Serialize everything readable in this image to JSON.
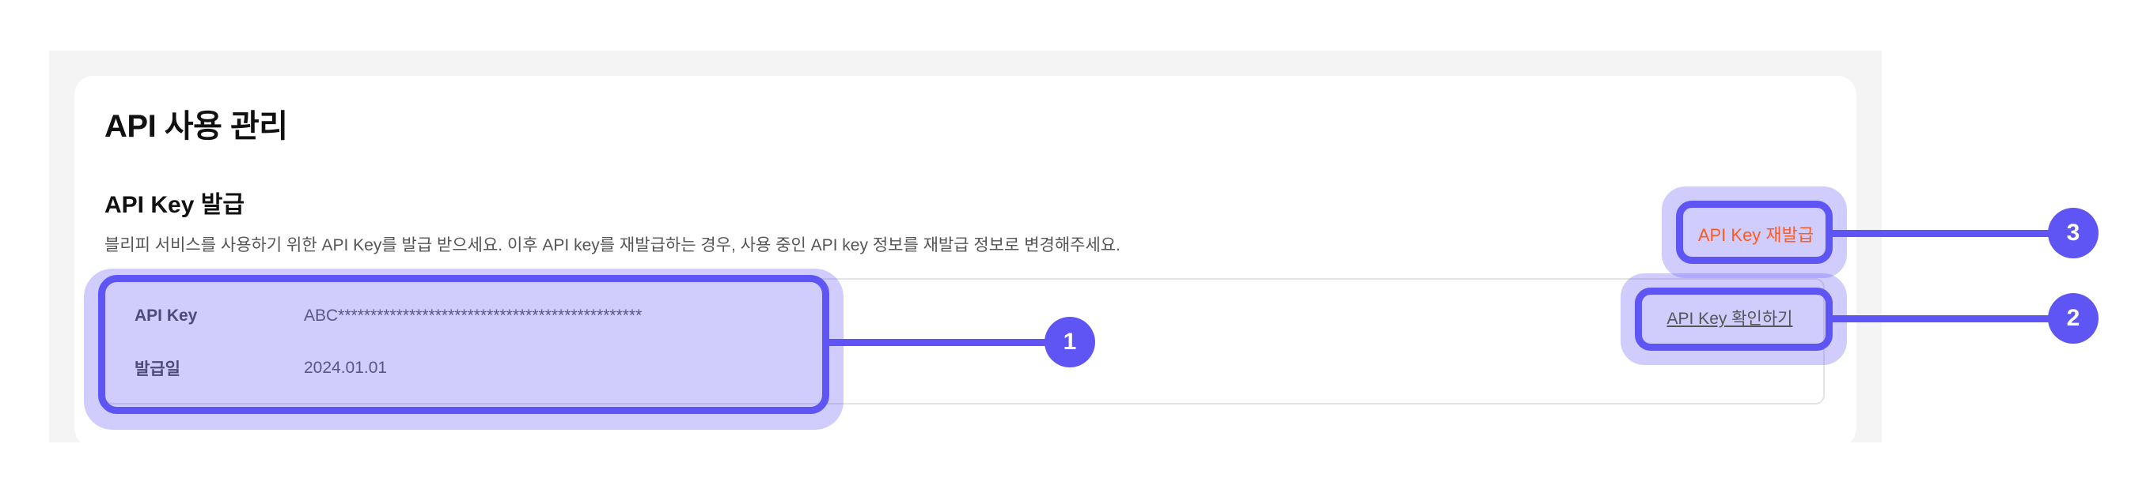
{
  "page": {
    "title": "API 사용 관리"
  },
  "section": {
    "title": "API Key 발급",
    "description": "블리피 서비스를 사용하기 위한 API Key를 발급 받으세요. 이후 API key를 재발급하는 경우, 사용 중인 API key 정보를 재발급 정보로 변경해주세요."
  },
  "api_info": {
    "key_label": "API Key",
    "key_value": "ABC***********************************************",
    "issued_label": "발급일",
    "issued_value": "2024.01.01"
  },
  "actions": {
    "reissue_label": "API Key 재발급",
    "view_label": "API Key 확인하기"
  },
  "annotations": {
    "badge_1": "1",
    "badge_2": "2",
    "badge_3": "3"
  },
  "colors": {
    "accent": "#5f55f4",
    "reissue_text": "#ff5a1f",
    "panel_bg": "#f4f4f4"
  }
}
